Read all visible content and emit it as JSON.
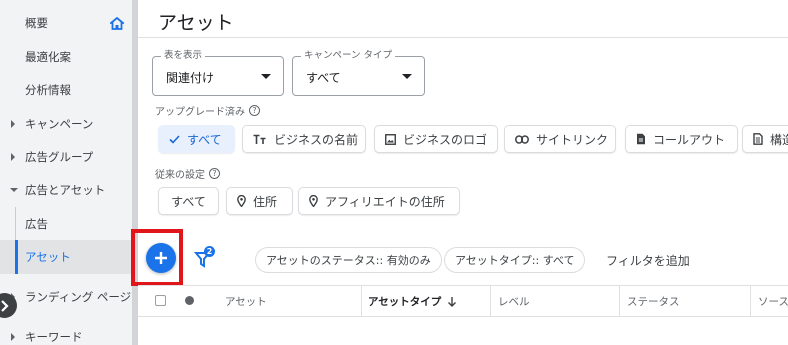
{
  "sidebar": {
    "items": [
      {
        "label": "概要"
      },
      {
        "label": "最適化案"
      },
      {
        "label": "分析情報"
      },
      {
        "label": "キャンペーン"
      },
      {
        "label": "広告グループ"
      },
      {
        "label": "広告とアセット"
      },
      {
        "label": "広告"
      },
      {
        "label": "アセット"
      },
      {
        "label": "ランディング ページ"
      },
      {
        "label": "キーワード"
      }
    ]
  },
  "main": {
    "title": "アセット",
    "view_dropdown": {
      "label": "表を表示",
      "value": "関連付け"
    },
    "campaign_type_dropdown": {
      "label": "キャンペーン タイプ",
      "value": "すべて"
    },
    "upgraded_section": {
      "label": "アップグレード済み",
      "chips": [
        "すべて",
        "ビジネスの名前",
        "ビジネスのロゴ",
        "サイトリンク",
        "コールアウト",
        "構造"
      ]
    },
    "legacy_section": {
      "label": "従来の設定",
      "chips": [
        "すべて",
        "住所",
        "アフィリエイトの住所"
      ]
    },
    "filter_bar": {
      "badge_count": "2",
      "chips": [
        "アセットのステータス:: 有効のみ",
        "アセットタイプ:: すべて"
      ],
      "add_filter": "フィルタを追加"
    },
    "table": {
      "columns": [
        "アセット",
        "アセットタイプ",
        "レベル",
        "ステータス",
        "ソース"
      ]
    }
  },
  "colors": {
    "accent": "#1a73e8",
    "highlight": "#e0161b",
    "selected_chip_bg": "#e8f0fe"
  }
}
